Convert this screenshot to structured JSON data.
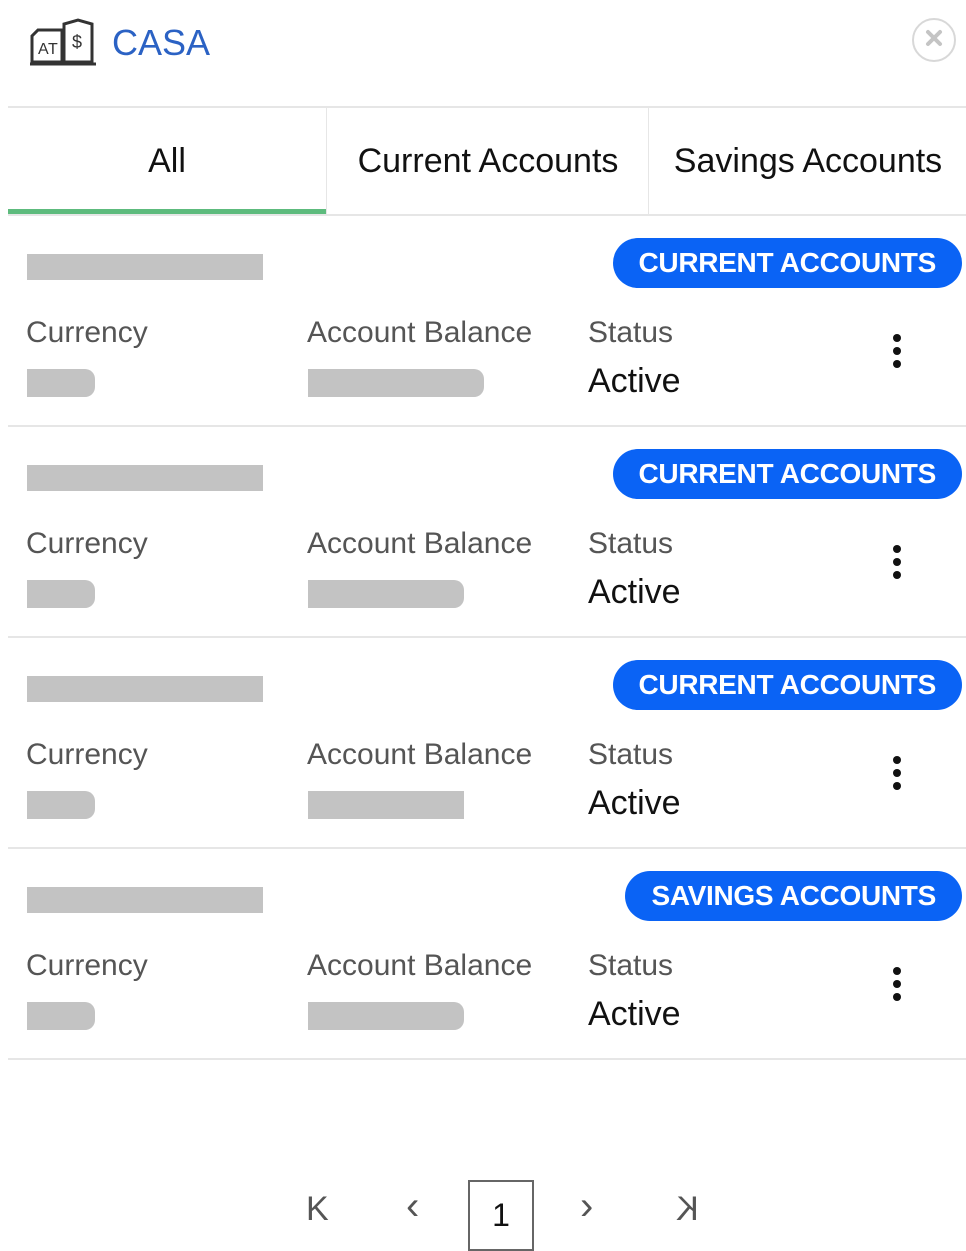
{
  "header": {
    "title": "CASA",
    "icon": "bank-building-icon",
    "close_icon": "close-icon"
  },
  "tabs": [
    {
      "label": "All",
      "active": true
    },
    {
      "label": "Current Accounts",
      "active": false
    },
    {
      "label": "Savings Accounts",
      "active": false
    }
  ],
  "labels": {
    "currency": "Currency",
    "balance": "Account Balance",
    "status": "Status"
  },
  "accounts": [
    {
      "badge": "CURRENT ACCOUNTS",
      "status": "Active"
    },
    {
      "badge": "CURRENT ACCOUNTS",
      "status": "Active"
    },
    {
      "badge": "CURRENT ACCOUNTS",
      "status": "Active"
    },
    {
      "badge": "SAVINGS ACCOUNTS",
      "status": "Active"
    }
  ],
  "pagination": {
    "first": "K",
    "prev": "‹",
    "current_page": "1",
    "next": "›",
    "last": "K"
  },
  "colors": {
    "accent": "#2b62c4",
    "badge": "#0a63f5",
    "tab_indicator": "#5dbb7d"
  }
}
